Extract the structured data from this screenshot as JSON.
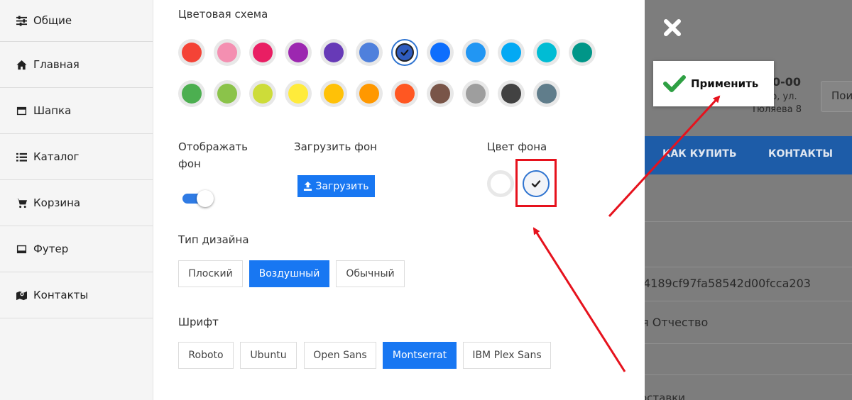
{
  "sidebar": {
    "items": [
      {
        "label": "Общие",
        "icon": "sliders-icon"
      },
      {
        "label": "Главная",
        "icon": "home-icon"
      },
      {
        "label": "Шапка",
        "icon": "window-icon"
      },
      {
        "label": "Каталог",
        "icon": "list-icon"
      },
      {
        "label": "Корзина",
        "icon": "cart-icon"
      },
      {
        "label": "Футер",
        "icon": "window-icon"
      },
      {
        "label": "Контакты",
        "icon": "map-icon"
      }
    ]
  },
  "settings": {
    "color_scheme_label": "Цветовая схема",
    "colors_row1": [
      "#f44336",
      "#f48fb1",
      "#e91e63",
      "#9c27b0",
      "#673ab7",
      "#4f80dc",
      "#2f5cbf",
      "#0d6efd",
      "#2196f3",
      "#03a9f4",
      "#00bcd4",
      "#009688"
    ],
    "colors_row2": [
      "#4caf50",
      "#8bc34a",
      "#cddc39",
      "#ffeb3b",
      "#ffc107",
      "#ff9800",
      "#ff5722",
      "#795548",
      "#9e9e9e",
      "#424242",
      "#607d8b"
    ],
    "selected_color": "#2f5cbf",
    "show_bg_label": "Отображать фон",
    "show_bg_on": true,
    "upload_bg_label": "Загрузить фон",
    "upload_button": "Загрузить",
    "bg_color_label": "Цвет фона",
    "bg_color_options": [
      "#ffffff",
      "#222222"
    ],
    "bg_color_selected": "#222222",
    "design_type_label": "Тип дизайна",
    "design_types": [
      "Плоский",
      "Воздушный",
      "Обычный"
    ],
    "design_type_selected": "Воздушный",
    "font_label": "Шрифт",
    "fonts": [
      "Roboto",
      "Ubuntu",
      "Open Sans",
      "Montserrat",
      "IBM Plex Sans"
    ],
    "font_selected": "Montserrat",
    "accent": "#1877f2"
  },
  "overlay": {
    "apply_button": "Применить",
    "close_icon": "close-icon",
    "phone_partial": "0-00",
    "address_partial_1": "ар, ул.",
    "address_partial_2": "Тюляева 8",
    "search_partial": "Пои",
    "nav_items": [
      "КАК КУПИТЬ",
      "КОНТАКТЫ"
    ],
    "hash_partial": "4189cf97fa58542d00fcca203",
    "name_partial": "я Отчество",
    "delivery_partial": "оставки"
  },
  "annotation_color": "#e6121d"
}
